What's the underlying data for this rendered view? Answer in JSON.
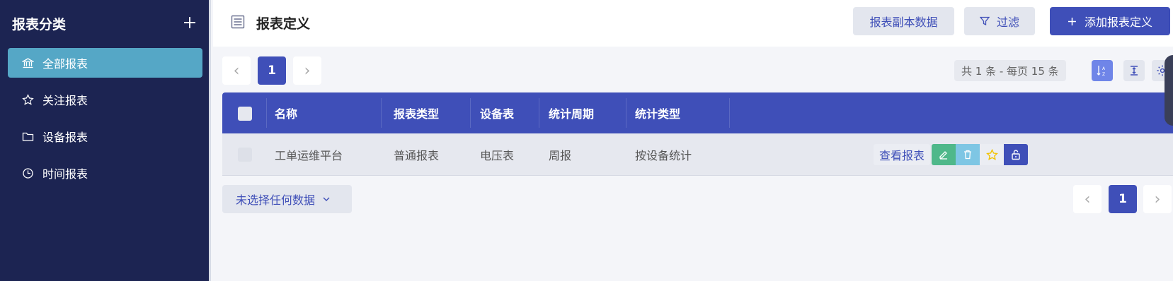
{
  "sidebar": {
    "title": "报表分类",
    "add_icon": "plus-icon",
    "items": [
      {
        "label": "全部报表",
        "icon": "bank-icon",
        "active": true
      },
      {
        "label": "关注报表",
        "icon": "star-icon",
        "active": false
      },
      {
        "label": "设备报表",
        "icon": "folder-icon",
        "active": false
      },
      {
        "label": "时间报表",
        "icon": "clock-icon",
        "active": false
      }
    ]
  },
  "header": {
    "icon": "list-icon",
    "title": "报表定义",
    "btn_copy": "报表副本数据",
    "btn_filter": "过滤",
    "btn_add": "添加报表定义"
  },
  "pagination_top": {
    "current": "1",
    "prev": "‹",
    "next": "›"
  },
  "summary": "共 1 条 - 每页 15 条",
  "table": {
    "headers": [
      "名称",
      "报表类型",
      "设备表",
      "统计周期",
      "统计类型"
    ],
    "rows": [
      {
        "name": "工单运维平台",
        "type": "普通报表",
        "device_table": "电压表",
        "period": "周报",
        "stat_type": "按设备统计",
        "action_view": "查看报表"
      }
    ]
  },
  "selection": {
    "label": "未选择任何数据"
  },
  "pagination_bottom": {
    "current": "1",
    "prev": "‹",
    "next": "›"
  },
  "colors": {
    "primary": "#3f4fb8",
    "sidebar": "#1c2452",
    "active": "#55a7c6",
    "edit": "#4fb88a",
    "delete": "#7ec6e4",
    "star": "#f2c200"
  }
}
